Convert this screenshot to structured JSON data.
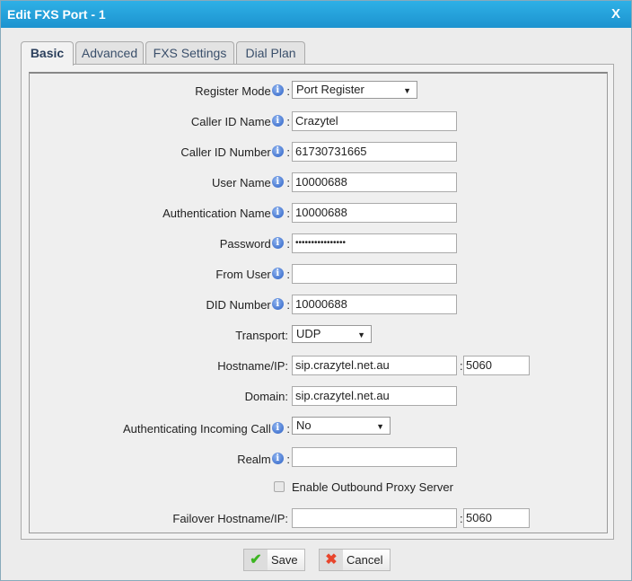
{
  "dialog": {
    "title": "Edit FXS Port - 1",
    "close_label": "X"
  },
  "tabs": [
    {
      "label": "Basic",
      "active": true
    },
    {
      "label": "Advanced"
    },
    {
      "label": "FXS Settings"
    },
    {
      "label": "Dial Plan"
    }
  ],
  "fields": {
    "register_mode": {
      "label": "Register Mode",
      "value": "Port Register"
    },
    "caller_id_name": {
      "label": "Caller ID Name",
      "value": "Crazytel"
    },
    "caller_id_number": {
      "label": "Caller ID Number",
      "value": "61730731665"
    },
    "user_name": {
      "label": "User Name",
      "value": "10000688"
    },
    "auth_name": {
      "label": "Authentication Name",
      "value": "10000688"
    },
    "password": {
      "label": "Password",
      "value": "••••••••••••••••"
    },
    "from_user": {
      "label": "From User",
      "value": ""
    },
    "did_number": {
      "label": "DID Number",
      "value": "10000688"
    },
    "transport": {
      "label": "Transport:",
      "value": "UDP"
    },
    "hostname": {
      "label": "Hostname/IP:",
      "value": "sip.crazytel.net.au",
      "port": "5060"
    },
    "domain": {
      "label": "Domain:",
      "value": "sip.crazytel.net.au"
    },
    "auth_incoming": {
      "label": "Authenticating Incoming Call",
      "value": "No"
    },
    "realm": {
      "label": "Realm",
      "value": ""
    },
    "outbound_proxy": {
      "label": "Enable Outbound Proxy Server",
      "checked": false
    },
    "failover": {
      "label": "Failover Hostname/IP:",
      "value": "",
      "port": "5060"
    }
  },
  "buttons": {
    "save": "Save",
    "cancel": "Cancel"
  },
  "colors": {
    "titlebar": "#1d9fdc",
    "save_icon": "#3cb521",
    "cancel_icon": "#e8452c"
  }
}
